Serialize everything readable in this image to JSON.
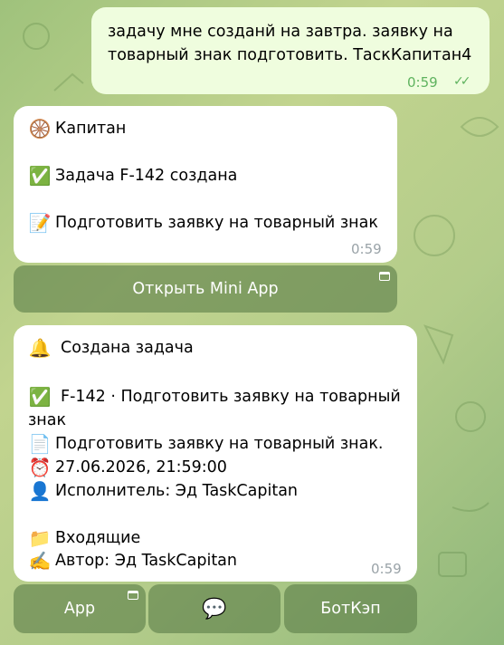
{
  "outgoing": {
    "line1": "задачу мне созданй на завтра. заявку на",
    "line2": "товарный знак подготовить. ТаскКапитан4",
    "time": "0:59",
    "status_glyph": "✓✓"
  },
  "msg1": {
    "header_emoji": "🛞",
    "header": "Капитан",
    "created_emoji": "✅",
    "created": "Задача F-142 создана",
    "task_emoji": "📝",
    "task": "Подготовить заявку на товарный знак",
    "time": "0:59"
  },
  "mini_app_button": {
    "label": "Открыть Mini App"
  },
  "msg2": {
    "bell_emoji": "🔔",
    "title": "Создана задача",
    "check_emoji": "✅",
    "task_line1": "F-142 · Подготовить заявку на товарный",
    "task_line2": "знак",
    "doc_emoji": "📄",
    "description": "Подготовить заявку на товарный знак.",
    "clock_emoji": "⏰",
    "deadline": "27.06.2026, 21:59:00",
    "person_emoji": "👤",
    "assignee": "Исполнитель: Эд TaskCapitan",
    "folder_emoji": "📁",
    "folder": "Входящие",
    "pen_emoji": "✍️",
    "author": "Автор: Эд TaskCapitan",
    "time": "0:59"
  },
  "bottom_buttons": {
    "app": "App",
    "chat_emoji": "💬",
    "botkep": "БотКэп"
  },
  "colors": {
    "outgoing_bubble": "#effdde",
    "incoming_bubble": "#ffffff",
    "button_bg": "#5c7e48",
    "tick": "#5fb35f"
  }
}
